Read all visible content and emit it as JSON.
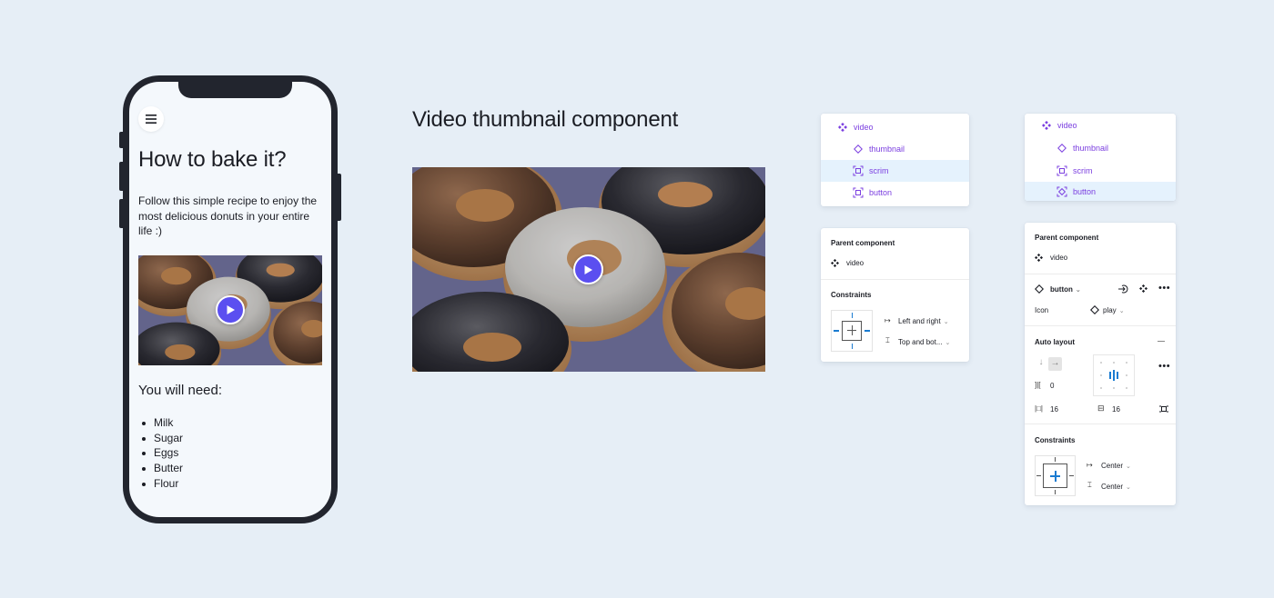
{
  "phone": {
    "title": "How to bake it?",
    "description": "Follow this simple recipe to enjoy the most delicious donuts in your entire life :)",
    "need_heading": "You will need:",
    "ingredients": [
      "Milk",
      "Sugar",
      "Eggs",
      "Butter",
      "Flour"
    ]
  },
  "center": {
    "title": "Video thumbnail component"
  },
  "layers_left": {
    "items": [
      {
        "label": "video",
        "icon": "component-icon",
        "selected": false
      },
      {
        "label": "thumbnail",
        "icon": "instance-icon",
        "selected": false
      },
      {
        "label": "scrim",
        "icon": "frame-icon",
        "selected": true
      },
      {
        "label": "button",
        "icon": "frame-icon",
        "selected": false
      }
    ]
  },
  "layers_right": {
    "items": [
      {
        "label": "video",
        "icon": "component-icon",
        "selected": false
      },
      {
        "label": "thumbnail",
        "icon": "instance-icon",
        "selected": false
      },
      {
        "label": "scrim",
        "icon": "frame-icon",
        "selected": false
      },
      {
        "label": "button",
        "icon": "instance-frame-icon",
        "selected": true
      }
    ]
  },
  "props_left": {
    "parent_heading": "Parent component",
    "parent_name": "video",
    "constraints_heading": "Constraints",
    "horizontal": "Left and right",
    "vertical": "Top and bot..."
  },
  "props_right": {
    "parent_heading": "Parent component",
    "parent_name": "video",
    "instance_name": "button",
    "icon_label": "Icon",
    "icon_value": "play",
    "auto_layout_heading": "Auto layout",
    "spacing": "0",
    "padding_h": "16",
    "padding_v": "16",
    "constraints_heading": "Constraints",
    "horizontal": "Center",
    "vertical": "Center"
  },
  "colors": {
    "background": "#e6eef6",
    "accent_purple": "#7b3fe0",
    "play_button": "#5b4ff0",
    "selection": "#e5f2fd",
    "constraint_blue": "#1a7bd1"
  }
}
